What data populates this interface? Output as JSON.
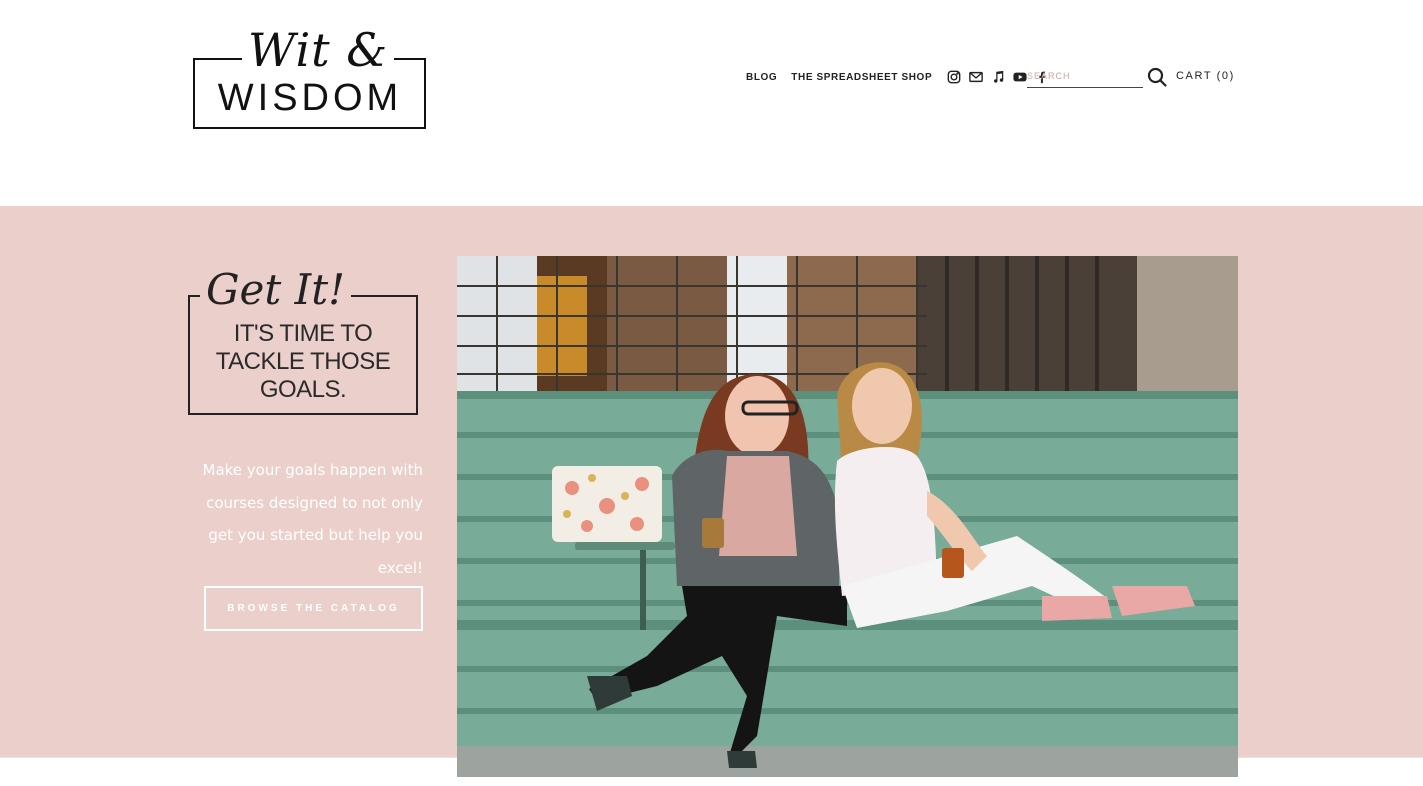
{
  "header": {
    "logo": {
      "script": "Wit &",
      "wordmark": "WISDOM"
    },
    "nav": [
      {
        "label": "BLOG"
      },
      {
        "label": "THE SPREADSHEET SHOP"
      }
    ],
    "social_icons": [
      "instagram-icon",
      "mail-icon",
      "music-icon",
      "youtube-icon",
      "facebook-icon"
    ],
    "search": {
      "placeholder": "SEARCH",
      "value": ""
    },
    "cart": {
      "label": "CART (0)"
    }
  },
  "hero": {
    "badge": {
      "script": "Get It!",
      "line1": "IT'S TIME TO",
      "line2": "TACKLE THOSE",
      "line3": "GOALS."
    },
    "copy": "Make your goals happen with courses designed to not only get you started but help you excel!",
    "cta_label": "BROWSE THE CATALOG",
    "background": "#ebcfcb"
  }
}
